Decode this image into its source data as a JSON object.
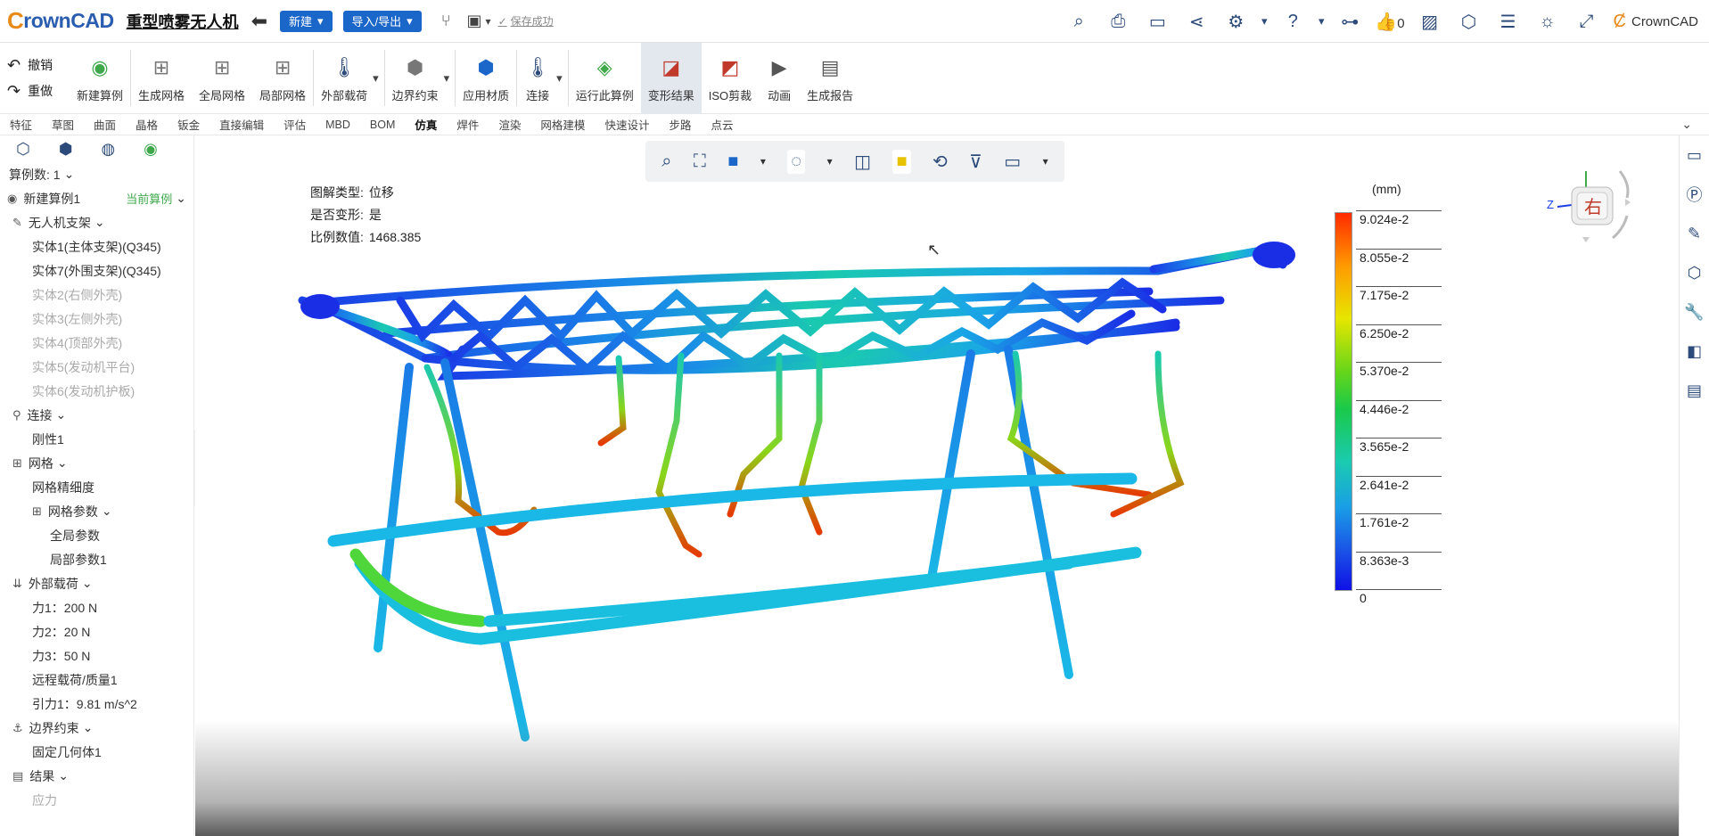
{
  "app": {
    "logo_prefix": "C",
    "logo_rest": "rownCAD",
    "doc_title": "重型喷雾无人机",
    "btn_new": "新建",
    "btn_import": "导入/导出",
    "saved": "保存成功",
    "likes": "0",
    "user": "CrownCAD"
  },
  "ribbon": {
    "undo": "撤销",
    "redo": "重做",
    "items": [
      "新建算例",
      "生成网格",
      "全局网格",
      "局部网格",
      "外部载荷",
      "边界约束",
      "应用材质",
      "连接",
      "运行此算例",
      "变形结果",
      "ISO剪裁",
      "动画",
      "生成报告"
    ]
  },
  "tabs": [
    "特征",
    "草图",
    "曲面",
    "钣金",
    "钣金",
    "直接编辑",
    "评估",
    "MBD",
    "BOM",
    "仿真",
    "焊件",
    "渲染",
    "网格建模",
    "快速设计",
    "步路",
    "点云"
  ],
  "sidebar": {
    "study_count": "算例数: 1",
    "study_name": "新建算例1",
    "current": "当前算例",
    "items": [
      {
        "t": "无人机支架",
        "lv": 1,
        "ic": "✎",
        "cls": "",
        "dd": true
      },
      {
        "t": "实体1(主体支架)(Q345)",
        "lv": 2,
        "cls": ""
      },
      {
        "t": "实体7(外围支架)(Q345)",
        "lv": 2,
        "cls": ""
      },
      {
        "t": "实体2(右侧外壳)",
        "lv": 2,
        "cls": "grey"
      },
      {
        "t": "实体3(左侧外壳)",
        "lv": 2,
        "cls": "grey"
      },
      {
        "t": "实体4(顶部外壳)",
        "lv": 2,
        "cls": "grey"
      },
      {
        "t": "实体5(发动机平台)",
        "lv": 2,
        "cls": "grey"
      },
      {
        "t": "实体6(发动机护板)",
        "lv": 2,
        "cls": "grey"
      },
      {
        "t": "连接",
        "lv": 1,
        "ic": "⚲",
        "dd": true
      },
      {
        "t": "刚性1",
        "lv": 2
      },
      {
        "t": "网格",
        "lv": 1,
        "ic": "⊞",
        "dd": true
      },
      {
        "t": "网格精细度",
        "lv": 2
      },
      {
        "t": "网格参数",
        "lv": 2,
        "ic": "⊞",
        "dd": true
      },
      {
        "t": "全局参数",
        "lv": 3
      },
      {
        "t": "局部参数1",
        "lv": 3
      },
      {
        "t": "外部载荷",
        "lv": 1,
        "ic": "⇊",
        "dd": true
      },
      {
        "t": "力1：200 N",
        "lv": 2
      },
      {
        "t": "力2：20 N",
        "lv": 2
      },
      {
        "t": "力3：50 N",
        "lv": 2
      },
      {
        "t": "远程载荷/质量1",
        "lv": 2
      },
      {
        "t": "引力1：9.81 m/s^2",
        "lv": 2
      },
      {
        "t": "边界约束",
        "lv": 1,
        "ic": "⚓",
        "dd": true
      },
      {
        "t": "固定几何体1",
        "lv": 2
      },
      {
        "t": "结果",
        "lv": 1,
        "ic": "▤",
        "dd": true
      },
      {
        "t": "应力",
        "lv": 2,
        "cls": "grey"
      }
    ]
  },
  "info": {
    "type_label": "图解类型:",
    "type_val": "位移",
    "deform_label": "是否变形:",
    "deform_val": "是",
    "scale_label": "比例数值:",
    "scale_val": "1468.385"
  },
  "legend": {
    "unit": "(mm)",
    "values": [
      "9.024e-2",
      "8.055e-2",
      "7.175e-2",
      "6.250e-2",
      "5.370e-2",
      "4.446e-2",
      "3.565e-2",
      "2.641e-2",
      "1.761e-2",
      "8.363e-3",
      "0"
    ]
  },
  "cube": {
    "face": "右",
    "axis_z": "Z"
  }
}
